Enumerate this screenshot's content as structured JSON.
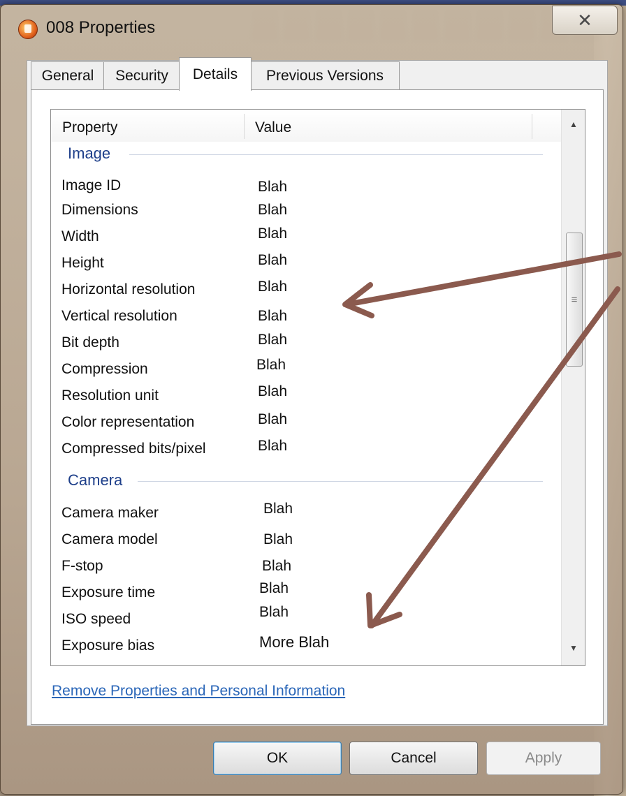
{
  "window": {
    "title": "008 Properties",
    "close_glyph": "✕"
  },
  "tabs": [
    {
      "label": "General"
    },
    {
      "label": "Security"
    },
    {
      "label": "Details"
    },
    {
      "label": "Previous Versions"
    }
  ],
  "active_tab": "Details",
  "list": {
    "columns": {
      "property": "Property",
      "value": "Value"
    },
    "groups": [
      {
        "label": "Image",
        "rows": [
          {
            "name": "Image ID",
            "value": "Blah"
          },
          {
            "name": "Dimensions",
            "value": "Blah"
          },
          {
            "name": "Width",
            "value": "Blah"
          },
          {
            "name": "Height",
            "value": "Blah"
          },
          {
            "name": "Horizontal resolution",
            "value": "Blah"
          },
          {
            "name": "Vertical resolution",
            "value": "Blah"
          },
          {
            "name": "Bit depth",
            "value": "Blah"
          },
          {
            "name": "Compression",
            "value": "Blah"
          },
          {
            "name": "Resolution unit",
            "value": "Blah"
          },
          {
            "name": "Color representation",
            "value": "Blah"
          },
          {
            "name": "Compressed bits/pixel",
            "value": "Blah"
          }
        ]
      },
      {
        "label": "Camera",
        "rows": [
          {
            "name": "Camera maker",
            "value": "Blah"
          },
          {
            "name": "Camera model",
            "value": "Blah"
          },
          {
            "name": "F-stop",
            "value": "Blah"
          },
          {
            "name": "Exposure time",
            "value": "Blah"
          },
          {
            "name": "ISO speed",
            "value": "Blah"
          },
          {
            "name": "Exposure bias",
            "value": "More Blah"
          }
        ]
      }
    ],
    "scrollbar": {
      "thumb_grip": "≡",
      "up": "▲",
      "down": "▼"
    }
  },
  "link_text": "Remove Properties and Personal Information",
  "buttons": {
    "ok": "OK",
    "cancel": "Cancel",
    "apply": "Apply"
  },
  "colors": {
    "arrow": "#8b5a4e",
    "group_label": "#1e3f8a",
    "link": "#2a66b8"
  }
}
